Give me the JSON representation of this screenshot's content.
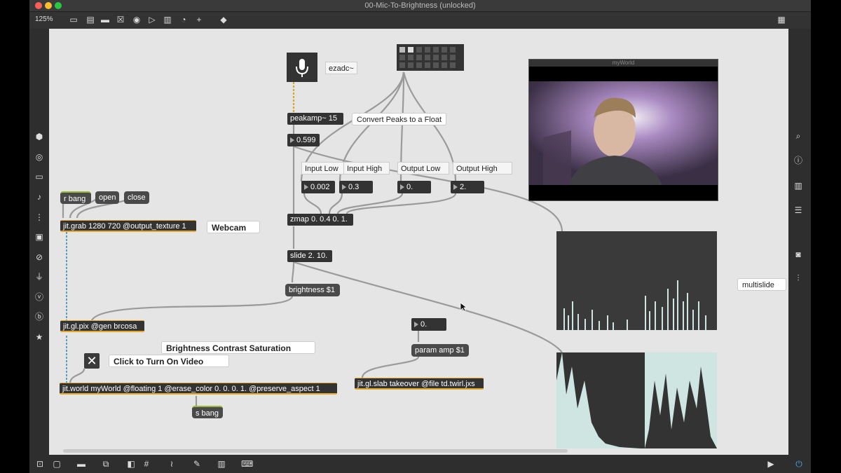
{
  "window": {
    "title": "00-Mic-To-Brightness (unlocked)",
    "zoom": "125%"
  },
  "objects": {
    "ezadc": "ezadc~",
    "peakamp": "peakamp~ 15",
    "zmap": "zmap 0. 0.4 0. 1.",
    "slide": "slide 2. 10.",
    "brightness": "brightness $1",
    "jitgrab": "jit.grab 1280 720 @output_texture 1",
    "jitglpix": "jit.gl.pix @gen brcosa",
    "jitworld": "jit.world myWorld @floating 1 @erase_color 0. 0. 0. 1. @preserve_aspect 1",
    "sbang": "s bang",
    "param": "param amp $1",
    "jitglslab": "jit.gl.slab takeover @file td.twirl.jxs",
    "multislider": "multislide"
  },
  "messages": {
    "rbang": "r bang",
    "open": "open",
    "close": "close"
  },
  "numbers": {
    "peak": "0.599",
    "input_low": "0.002",
    "input_high": "0.3",
    "output_low": "0.",
    "output_high": "2.",
    "amp": "0."
  },
  "comments": {
    "convert": "Convert Peaks to a Float",
    "input_low": "Input Low",
    "input_high": "Input High",
    "output_low": "Output Low",
    "output_high": "Output High",
    "webcam": "Webcam",
    "brcosa": "Brightness Contrast Saturation",
    "video_on": "Click to Turn On Video"
  },
  "video_window": {
    "title": "myWorld"
  },
  "colors": {
    "canvas": "#e5e5e5",
    "object": "#333333",
    "jitter_accent": "#e7a42a",
    "slider_fill": "#cfe5e2"
  },
  "icons": {
    "toolbar": [
      "new-object-icon",
      "new-message-icon",
      "comment-icon",
      "toggle-icon",
      "button-icon",
      "inlet-icon",
      "slider-icon",
      "dial-icon",
      "plus-icon",
      "paint-bucket-icon",
      "grid-icon"
    ],
    "left_sidebar": [
      "cube-icon",
      "target-icon",
      "film-icon",
      "music-note-icon",
      "sequencer-icon",
      "image-icon",
      "paperclip-icon",
      "plug-icon",
      "vizzie-icon",
      "beap-icon",
      "star-icon"
    ],
    "right_sidebar": [
      "search-icon",
      "info-icon",
      "book-icon",
      "list-icon",
      "camera-icon",
      "mixer-icon"
    ],
    "bottom": [
      "lock-icon",
      "presentation-icon",
      "comment-bubble-icon",
      "duplicate-icon",
      "arrange-icon",
      "grid-icon",
      "patch-cord-icon",
      "wrench-icon",
      "keyboard-icon",
      "piano-icon",
      "play-icon",
      "power-icon"
    ]
  }
}
